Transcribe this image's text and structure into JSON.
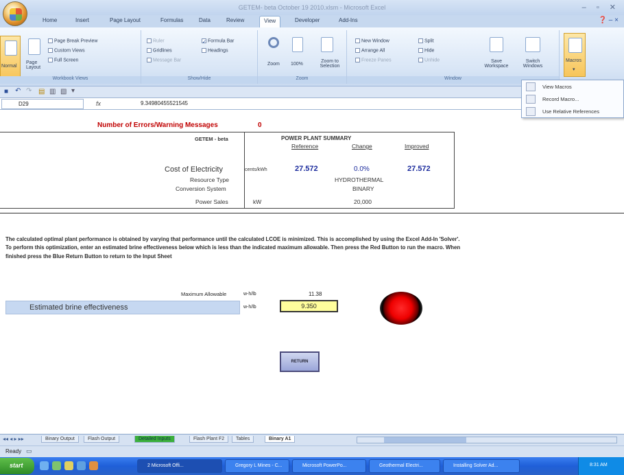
{
  "window": {
    "title": "GETEM- beta October 19 2010.xlsm - Microsoft Excel",
    "controls": "– ▫ ✕"
  },
  "ribbon_tabs": [
    "Home",
    "Insert",
    "Page Layout",
    "Formulas",
    "Data",
    "Review",
    "View",
    "Developer",
    "Add-Ins"
  ],
  "active_tab": "View",
  "ribbon": {
    "workbook_views": {
      "label": "Workbook Views",
      "normal": "Normal",
      "page_layout": "Page Layout",
      "page_break": "Page Break Preview",
      "custom_views": "Custom Views",
      "full_screen": "Full Screen"
    },
    "show_hide": {
      "label": "Show/Hide",
      "ruler": "Ruler",
      "gridlines": "Gridlines",
      "message_bar": "Message Bar",
      "formula_bar": "Formula Bar",
      "headings": "Headings"
    },
    "zoom": {
      "label": "Zoom",
      "zoom": "Zoom",
      "hundred": "100%",
      "zoom_sel": "Zoom to Selection"
    },
    "window": {
      "label": "Window",
      "new_window": "New Window",
      "arrange_all": "Arrange All",
      "freeze_panes": "Freeze Panes",
      "split": "Split",
      "hide": "Hide",
      "unhide": "Unhide",
      "save_ws": "Save Workspace",
      "switch_win": "Switch Windows"
    },
    "macros": {
      "label": "Macros"
    }
  },
  "macros_menu": [
    "View Macros",
    "Record Macro...",
    "Use Relative References"
  ],
  "name_box": "D29",
  "fx": "fx",
  "formula_value": "9.34980455521545",
  "sheet": {
    "error_label": "Number of Errors/Warning Messages",
    "error_count": "0",
    "getem": "GETEM - beta",
    "summary_title": "POWER PLANT SUMMARY",
    "col_reference": "Reference",
    "col_change": "Change",
    "col_improved": "Improved",
    "coe_label": "Cost of Electricity",
    "coe_unit": "cents/kWh",
    "coe_ref": "27.572",
    "coe_change": "0.0%",
    "coe_improved": "27.572",
    "resource_label": "Resource Type",
    "resource_val": "HYDROTHERMAL",
    "conversion_label": "Conversion System",
    "conversion_val": "BINARY",
    "sales_label": "Power Sales",
    "sales_unit": "kW",
    "sales_val": "20,000",
    "paragraph": "The calculated optimal plant performance is obtained by varying that performance until the calculated LCOE is minimized. This is accomplished by using the Excel Add-In 'Solver'. To perform this optimization, enter an estimated brine effectiveness below which is less than the indicated maximum allowable. Then press the Red Button to run the macro. When finished press the Blue Return Button to return to the Input Sheet",
    "max_label": "Maximum Allowable",
    "max_unit": "w-h/lb",
    "max_val": "11.38",
    "eff_label": "Estimated brine effectiveness",
    "eff_unit": "w-h/lb",
    "eff_val": "9.350",
    "return_label": "RETURN"
  },
  "sheet_tabs": [
    "Binary Output",
    "Flash Output",
    "Detailed Inputs",
    "Flash Plant F2",
    "Tables",
    "Binary A1"
  ],
  "active_sheet": "Binary A1",
  "status": "Ready",
  "taskbar": {
    "start": "start",
    "tasks": [
      "2 Microsoft Offi...",
      "Gregory L Mines - C...",
      "Microsoft PowerPo...",
      "Geothermal Electri...",
      "Installing Solver Ad..."
    ],
    "clock": "8:31 AM"
  }
}
